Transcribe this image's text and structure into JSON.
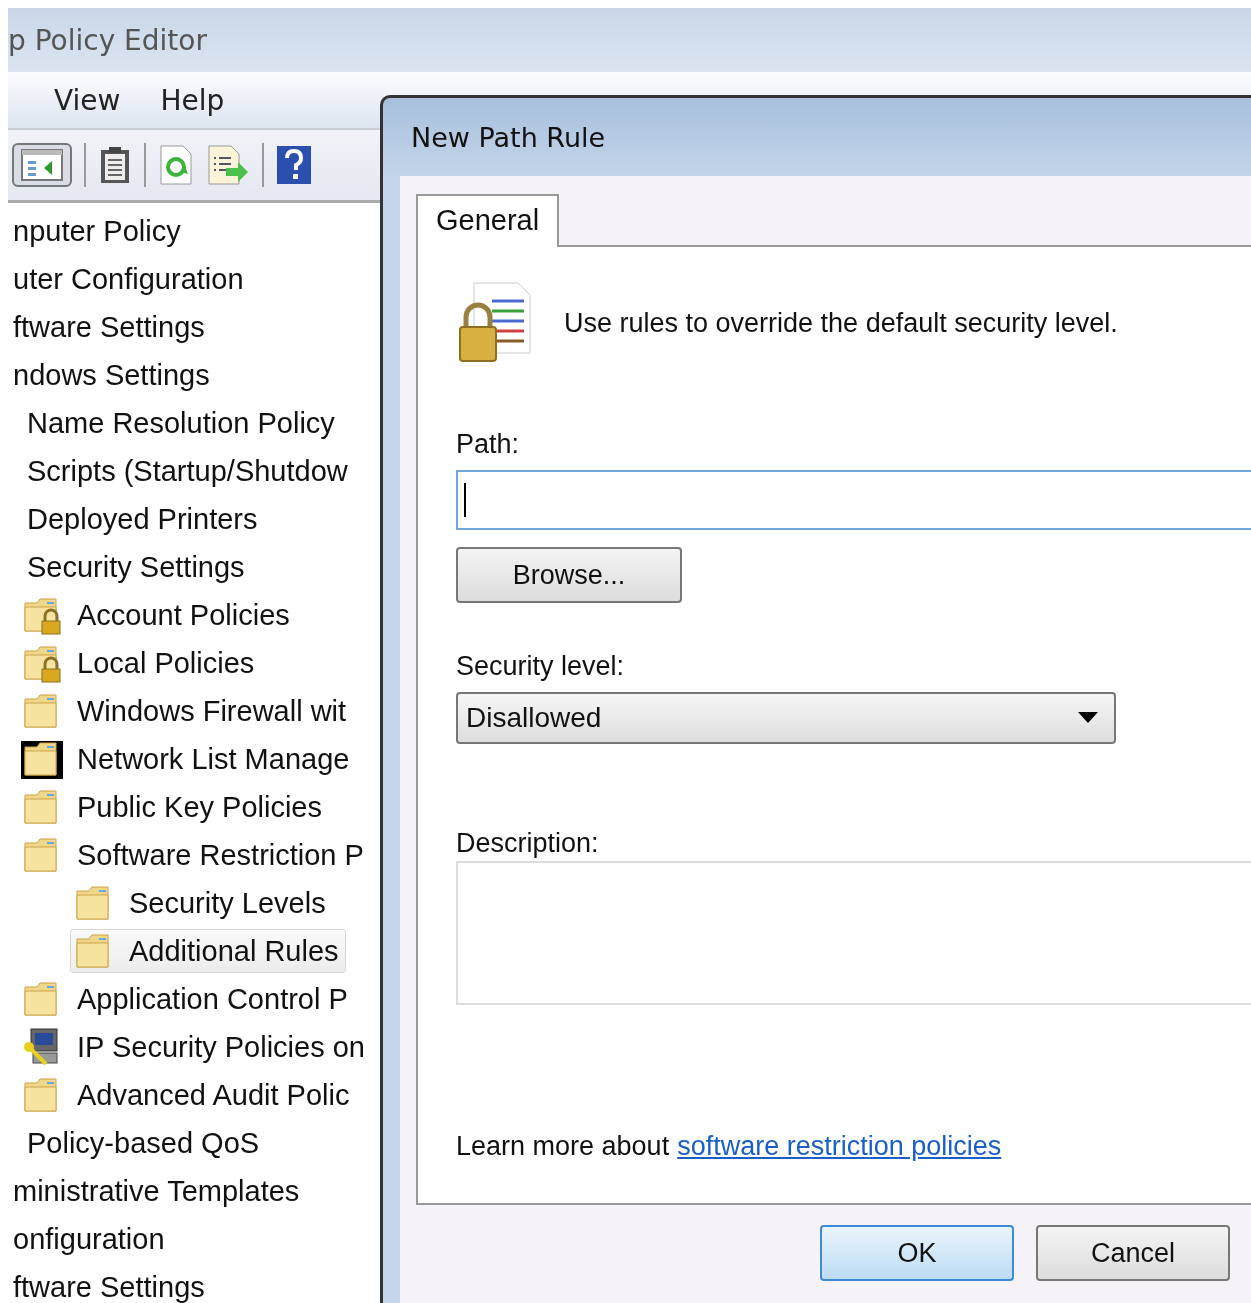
{
  "main_window": {
    "title": "p Policy Editor",
    "menu": [
      "View",
      "Help"
    ],
    "tree": [
      {
        "label": "nputer Policy",
        "selected": false,
        "children": [
          {
            "label": "uter Configuration",
            "selected": false,
            "children": [
              {
                "label": "ftware Settings",
                "selected": false
              },
              {
                "label": "ndows Settings",
                "selected": false,
                "children": [
                  {
                    "label": "Name Resolution Policy",
                    "selected": false
                  },
                  {
                    "label": "Scripts (Startup/Shutdow",
                    "selected": false
                  },
                  {
                    "label": "Deployed Printers",
                    "selected": false
                  },
                  {
                    "label": "Security Settings",
                    "selected": false,
                    "children": [
                      {
                        "label": "Account Policies",
                        "kind": "locked",
                        "selected": false
                      },
                      {
                        "label": "Local Policies",
                        "kind": "locked",
                        "selected": false
                      },
                      {
                        "label": "Windows Firewall wit",
                        "kind": "folder",
                        "selected": false
                      },
                      {
                        "label": "Network List Manage",
                        "kind": "framed",
                        "selected": false
                      },
                      {
                        "label": "Public Key Policies",
                        "kind": "folder",
                        "selected": false
                      },
                      {
                        "label": "Software Restriction P",
                        "kind": "folder",
                        "selected": false,
                        "children": [
                          {
                            "label": "Security Levels",
                            "kind": "folder",
                            "selected": false
                          },
                          {
                            "label": "Additional Rules",
                            "kind": "folder",
                            "selected": true
                          }
                        ]
                      },
                      {
                        "label": "Application Control P",
                        "kind": "folder",
                        "selected": false
                      },
                      {
                        "label": "IP Security Policies on",
                        "kind": "computer",
                        "selected": false
                      },
                      {
                        "label": "Advanced Audit Polic",
                        "kind": "folder",
                        "selected": false
                      }
                    ]
                  },
                  {
                    "label": "Policy-based QoS",
                    "selected": false
                  }
                ]
              },
              {
                "label": "ministrative Templates",
                "selected": false
              }
            ]
          },
          {
            "label": "onfiguration",
            "selected": false,
            "children": [
              {
                "label": "ftware Settings",
                "selected": false
              }
            ]
          }
        ]
      }
    ]
  },
  "dialog": {
    "title": "New Path Rule",
    "tabs": [
      {
        "label": "General",
        "selected": true
      }
    ],
    "intro": "Use rules to override the default security level.",
    "path": {
      "label": "Path:",
      "focused": true
    },
    "browse_button": "Browse...",
    "security_level": {
      "label": "Security level:",
      "value": "Disallowed"
    },
    "description": {
      "label": "Description:"
    },
    "learn_more": {
      "text": "Learn more about",
      "link": "software restriction policies"
    },
    "buttons": [
      {
        "label": "OK",
        "kind": "default"
      },
      {
        "label": "Cancel",
        "kind": "normal"
      }
    ]
  }
}
